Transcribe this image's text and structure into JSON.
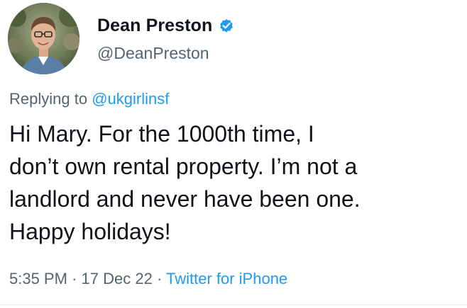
{
  "author": {
    "display_name": "Dean Preston",
    "handle": "@DeanPreston",
    "verified": true,
    "avatar_icon": "profile-photo-icon",
    "verified_icon": "verified-badge-icon"
  },
  "reply": {
    "prefix": "Replying to",
    "mention": "@ukgirlinsf"
  },
  "tweet": {
    "lines": [
      "Hi Mary. For the 1000th time, I",
      "don’t own rental property. I’m not a",
      "landlord and never have been one.",
      "Happy holidays!"
    ]
  },
  "meta": {
    "time": "5:35 PM",
    "separator": "·",
    "date": "17 Dec 22",
    "source": "Twitter for iPhone"
  },
  "colors": {
    "text": "#0f1419",
    "secondary": "#536471",
    "accent": "#1d9bf0"
  }
}
